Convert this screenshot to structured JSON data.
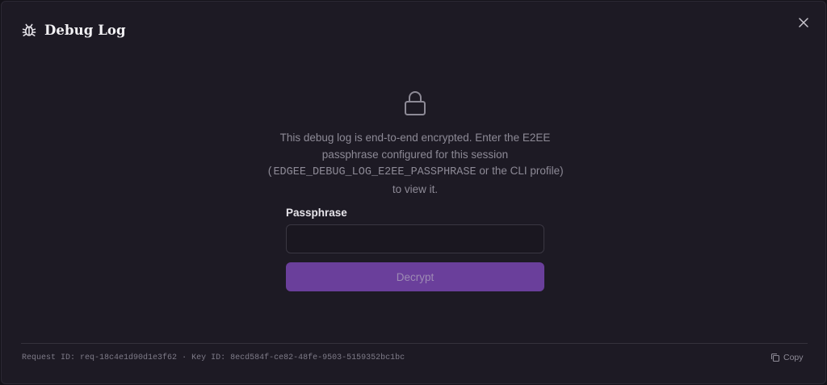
{
  "header": {
    "title": "Debug Log",
    "icon": "bug-icon"
  },
  "close": {
    "icon": "close-icon"
  },
  "lock": {
    "icon": "lock-icon"
  },
  "message": {
    "line1": "This debug log is end-to-end encrypted. Enter the E2EE",
    "line2": "passphrase configured for this session",
    "env_var": "(EDGEE_DEBUG_LOG_E2EE_PASSPHRASE",
    "line3_rest": " or the CLI profile)",
    "line4": "to view it."
  },
  "form": {
    "label": "Passphrase",
    "value": "",
    "button_label": "Decrypt"
  },
  "footer": {
    "request_label": "Request ID:",
    "request_id": "req-18c4e1d90d1e3f62",
    "separator": "·",
    "key_label": "Key ID:",
    "key_id": "8ecd584f-ce82-48fe-9503-5159352bc1bc",
    "copy_label": "Copy",
    "copy_icon": "copy-icon"
  },
  "colors": {
    "background": "#1d1a24",
    "accent": "#6a3f9b",
    "text_primary": "#f2f1f4",
    "text_muted": "#8d8a96"
  }
}
